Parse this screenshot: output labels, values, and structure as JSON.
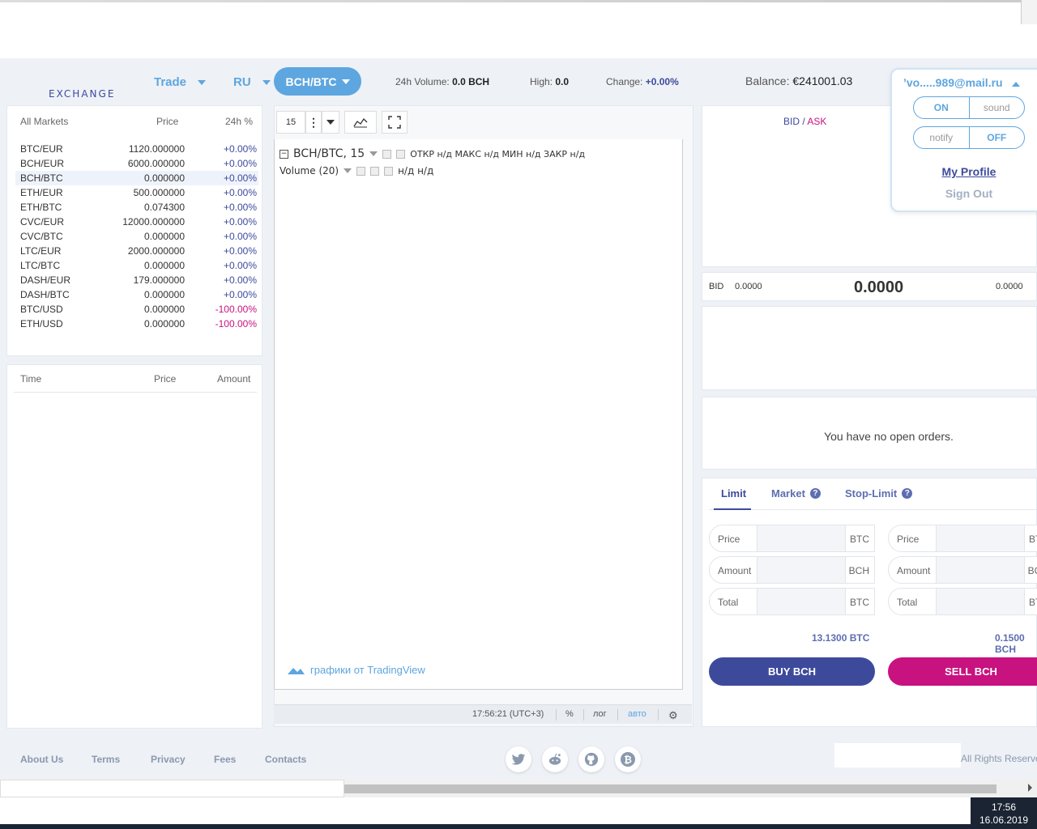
{
  "header": {
    "logo": "EXCHANGE",
    "nav_trade": "Trade",
    "nav_lang": "RU",
    "pair": "BCH/BTC",
    "volume_label": "24h Volume:",
    "volume_value": "0.0 BCH",
    "high_label": "High:",
    "high_value": "0.0",
    "change_label": "Change:",
    "change_value": "+0.00%",
    "balance_label": "Balance:",
    "balance_value": "€241001.03"
  },
  "user_menu": {
    "email": "’vo.....989@mail.ru",
    "toggle1": [
      "ON",
      "sound"
    ],
    "toggle2": [
      "notify",
      "OFF"
    ],
    "my_profile": "My Profile",
    "sign_out": "Sign Out"
  },
  "markets": {
    "headers": [
      "All Markets",
      "Price",
      "24h %"
    ],
    "rows": [
      {
        "pair": "BTC/EUR",
        "price": "1120.000000",
        "change": "+0.00%"
      },
      {
        "pair": "BCH/EUR",
        "price": "6000.000000",
        "change": "+0.00%"
      },
      {
        "pair": "BCH/BTC",
        "price": "0.000000",
        "change": "+0.00%"
      },
      {
        "pair": "ETH/EUR",
        "price": "500.000000",
        "change": "+0.00%"
      },
      {
        "pair": "ETH/BTC",
        "price": "0.074300",
        "change": "+0.00%"
      },
      {
        "pair": "CVC/EUR",
        "price": "12000.000000",
        "change": "+0.00%"
      },
      {
        "pair": "CVC/BTC",
        "price": "0.000000",
        "change": "+0.00%"
      },
      {
        "pair": "LTC/EUR",
        "price": "2000.000000",
        "change": "+0.00%"
      },
      {
        "pair": "LTC/BTC",
        "price": "0.000000",
        "change": "+0.00%"
      },
      {
        "pair": "DASH/EUR",
        "price": "179.000000",
        "change": "+0.00%"
      },
      {
        "pair": "DASH/BTC",
        "price": "0.000000",
        "change": "+0.00%"
      },
      {
        "pair": "BTC/USD",
        "price": "0.000000",
        "change": "-100.00%"
      },
      {
        "pair": "ETH/USD",
        "price": "0.000000",
        "change": "-100.00%"
      }
    ]
  },
  "trades": {
    "headers": [
      "Time",
      "Price",
      "Amount"
    ]
  },
  "chart": {
    "interval": "15",
    "legend_title": "BCH/BTC, 15",
    "ohlc": "ОТКР н/д  МАКС н/д  МИН н/д  ЗАКР н/д",
    "volume": "Volume (20)",
    "volume_vals": "н/д  н/д",
    "credit": "графики от TradingView",
    "time": "17:56:21 (UTC+3)",
    "percent": "%",
    "log": "лог",
    "auto": "авто"
  },
  "orderbook": {
    "bid": "BID",
    "slash": " / ",
    "ask": "ASK",
    "mid_bid_label": "BID",
    "mid_bid_value": "0.0000",
    "mid_price": "0.0000",
    "mid_ask_value": "0.0000"
  },
  "open_orders": {
    "message": "You have no open orders."
  },
  "trade_form": {
    "tabs": [
      "Limit",
      "Market",
      "Stop-Limit"
    ],
    "help_glyph": "?",
    "buy": {
      "fields": [
        {
          "label": "Price",
          "currency": "BTC"
        },
        {
          "label": "Amount",
          "currency": "BCH"
        },
        {
          "label": "Total",
          "currency": "BTC"
        }
      ],
      "available": "13.1300 BTC",
      "button": "BUY BCH"
    },
    "sell": {
      "fields": [
        {
          "label": "Price",
          "currency": "BTC"
        },
        {
          "label": "Amount",
          "currency": "BCH"
        },
        {
          "label": "Total",
          "currency": "BTC"
        }
      ],
      "available": "0.1500 BCH",
      "button": "SELL BCH"
    }
  },
  "footer": {
    "links": [
      "About Us",
      "Terms",
      "Privacy",
      "Fees",
      "Contacts"
    ],
    "rights": "All Rights Reserved"
  },
  "taskbar": {
    "time": "17:56",
    "date": "16.06.2019"
  },
  "colors": {
    "accent": "#5ea6df",
    "buy": "#3d4a9c",
    "sell": "#c8127f"
  }
}
